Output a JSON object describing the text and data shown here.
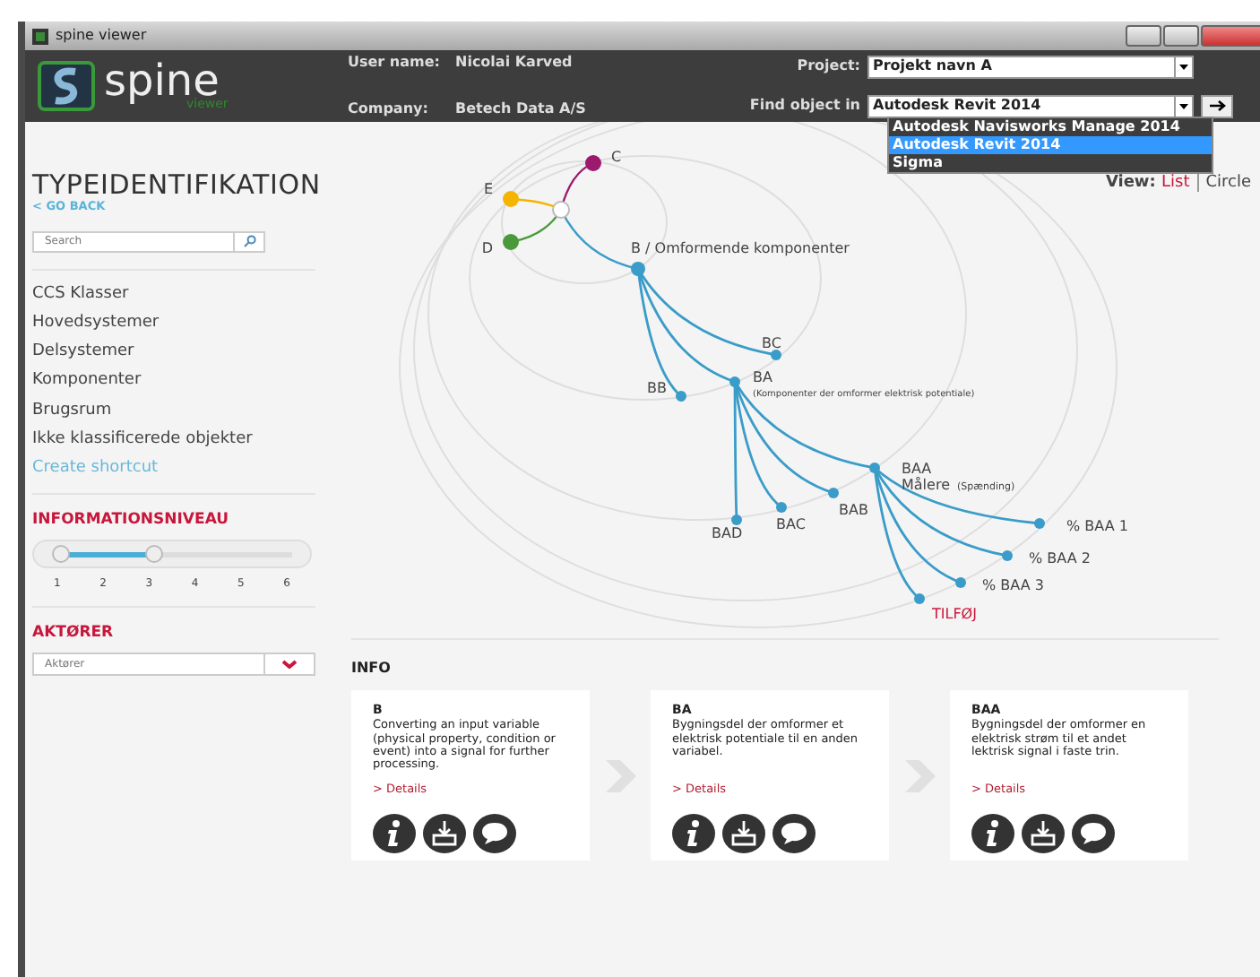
{
  "window": {
    "title": "spine viewer"
  },
  "header": {
    "logo": "spine",
    "logo_sub": "viewer",
    "user_label": "User name:",
    "user": "Nicolai Karved",
    "company_label": "Company:",
    "company": "Betech Data A/S",
    "project_label": "Project:",
    "project": "Projekt navn A",
    "find_label": "Find object in",
    "find_value": "Autodesk Revit 2014",
    "find_options": [
      {
        "label": "Autodesk Navisworks Manage 2014",
        "selected": false
      },
      {
        "label": "Autodesk Revit 2014",
        "selected": true
      },
      {
        "label": "Sigma",
        "selected": false
      }
    ]
  },
  "page": {
    "title": "TYPEIDENTIFIKATION",
    "back": "< GO BACK",
    "view_label": "View:",
    "views": [
      {
        "label": "List",
        "selected": true
      },
      {
        "label": "Circle",
        "selected": false
      }
    ]
  },
  "sidebar": {
    "search_placeholder": "Search",
    "items": [
      {
        "label": "CCS Klasser"
      },
      {
        "label": "Hovedsystemer"
      },
      {
        "label": "Delsystemer"
      },
      {
        "label": "Komponenter"
      },
      {
        "label": "Brugsrum"
      },
      {
        "label": "Ikke klassificerede objekter"
      }
    ],
    "shortcut": "Create shortcut",
    "level_title": "INFORMATIONSNIVEAU",
    "slider": {
      "handles": [
        {
          "level": 0
        },
        {
          "level": 0.4
        }
      ],
      "ticks": [
        "1",
        "2",
        "3",
        "4",
        "5",
        "6"
      ]
    },
    "actors_title": "AKTØRER",
    "actors_placeholder": "Aktører"
  },
  "diagram": {
    "nodes": [
      {
        "label": "C",
        "color": "#9c1a6e"
      },
      {
        "label": "E",
        "color": "#f5b400"
      },
      {
        "label": "D",
        "color": "#4a9a3c"
      },
      {
        "label": "B / Omformende komponenter",
        "color": "#3a9cc8"
      },
      {
        "label": "BC",
        "color": "#3a9cc8"
      },
      {
        "label": "BB",
        "color": "#3a9cc8"
      },
      {
        "label": "BA",
        "sub": "(Komponenter der omformer elektrisk potentiale)",
        "color": "#3a9cc8"
      },
      {
        "label": "BAA",
        "label2": "Målere",
        "sub": "(Spænding)",
        "color": "#3a9cc8"
      },
      {
        "label": "BAB",
        "color": "#3a9cc8"
      },
      {
        "label": "BAC",
        "color": "#3a9cc8"
      },
      {
        "label": "BAD",
        "color": "#3a9cc8"
      },
      {
        "label": "% BAA 1",
        "color": "#3a9cc8"
      },
      {
        "label": "% BAA 2",
        "color": "#3a9cc8"
      },
      {
        "label": "% BAA 3",
        "color": "#3a9cc8"
      },
      {
        "label": "TILFØJ",
        "kind": "add",
        "color": "#3a9cc8"
      }
    ]
  },
  "info": {
    "title": "INFO",
    "cards": [
      {
        "title": "B",
        "text": "Converting an input variable (physical property, condition or event) into a signal for further processing.",
        "link": "> Details"
      },
      {
        "title": "BA",
        "text": "Bygningsdel der omformer et elektrisk potentiale til en anden variabel.",
        "link": "> Details"
      },
      {
        "title": "BAA",
        "text": "Bygningsdel der omformer en elektrisk strøm til et andet lektrisk signal i faste trin.",
        "link": "> Details"
      }
    ]
  }
}
